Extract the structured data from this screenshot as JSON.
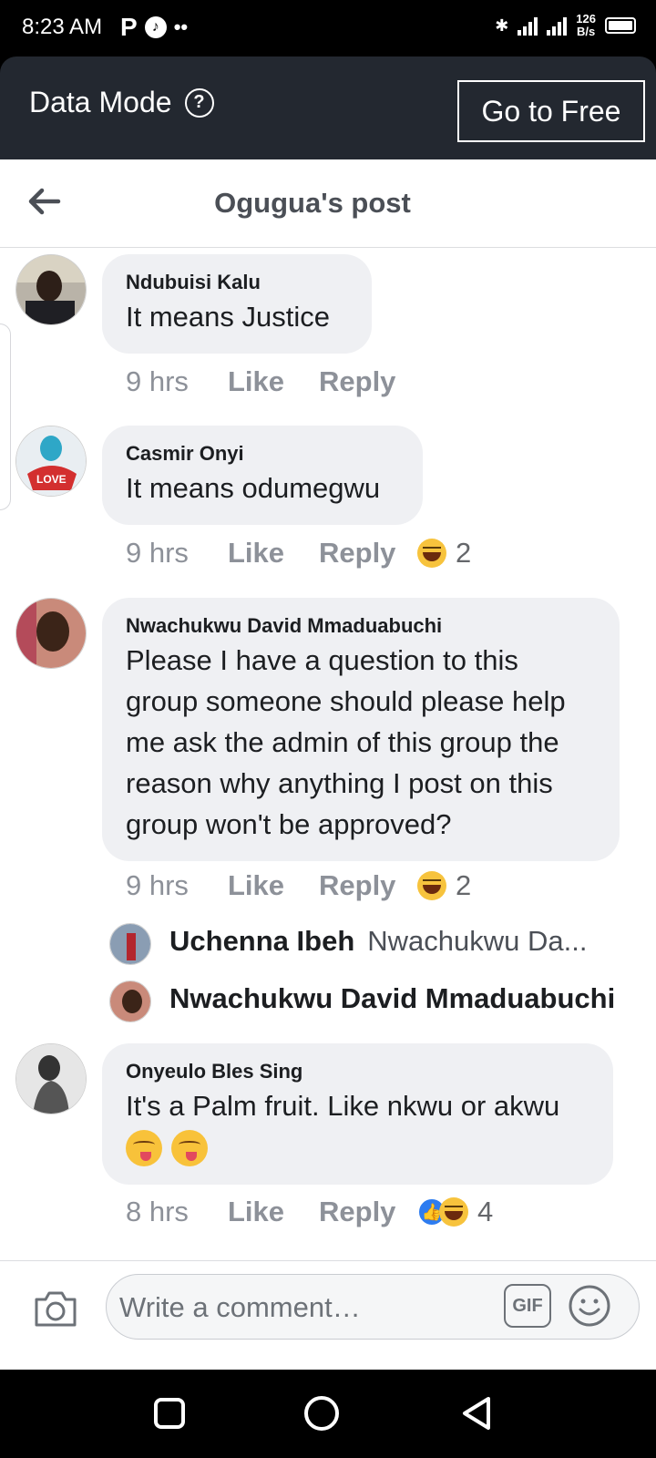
{
  "status_bar": {
    "time": "8:23 AM",
    "net_speed_value": "126",
    "net_speed_unit": "B/s",
    "network_type": "4G"
  },
  "data_bar": {
    "label": "Data Mode",
    "help_glyph": "?",
    "go_free_label": "Go to Free"
  },
  "header": {
    "title": "Ogugua's post",
    "back_icon": "back-arrow-icon"
  },
  "comments": [
    {
      "author": "Ndubuisi Kalu",
      "text": "It means Justice",
      "time": "9 hrs",
      "like": "Like",
      "reply": "Reply"
    },
    {
      "author": "Casmir Onyi",
      "text": "It means odumegwu",
      "time": "9 hrs",
      "like": "Like",
      "reply": "Reply",
      "reaction_count": "2"
    },
    {
      "author": "Nwachukwu David Mmaduabuchi",
      "text": "Please I have a question to this group someone should please help me ask the admin of this group the reason why anything I post on this group won't be approved?",
      "time": "9 hrs",
      "like": "Like",
      "reply": "Reply",
      "reaction_count": "2"
    },
    {
      "author": "Onyeulo Bles Sing",
      "text": "It's a Palm fruit. Like nkwu or akwu",
      "time": "8 hrs",
      "like": "Like",
      "reply": "Reply",
      "reaction_count": "4"
    }
  ],
  "replies": [
    {
      "author": "Uchenna Ibeh",
      "preview": "Nwachukwu Da..."
    },
    {
      "author": "Nwachukwu David Mmaduabuchi",
      "preview": ""
    }
  ],
  "comment_bar": {
    "placeholder": "Write a comment…",
    "gif_label": "GIF"
  },
  "colors": {
    "data_bar_bg": "#232830",
    "bubble_bg": "#eff0f3",
    "meta_text": "#8d9199",
    "like_blue": "#2d7cf0",
    "emoji_yellow": "#f7c33d"
  }
}
